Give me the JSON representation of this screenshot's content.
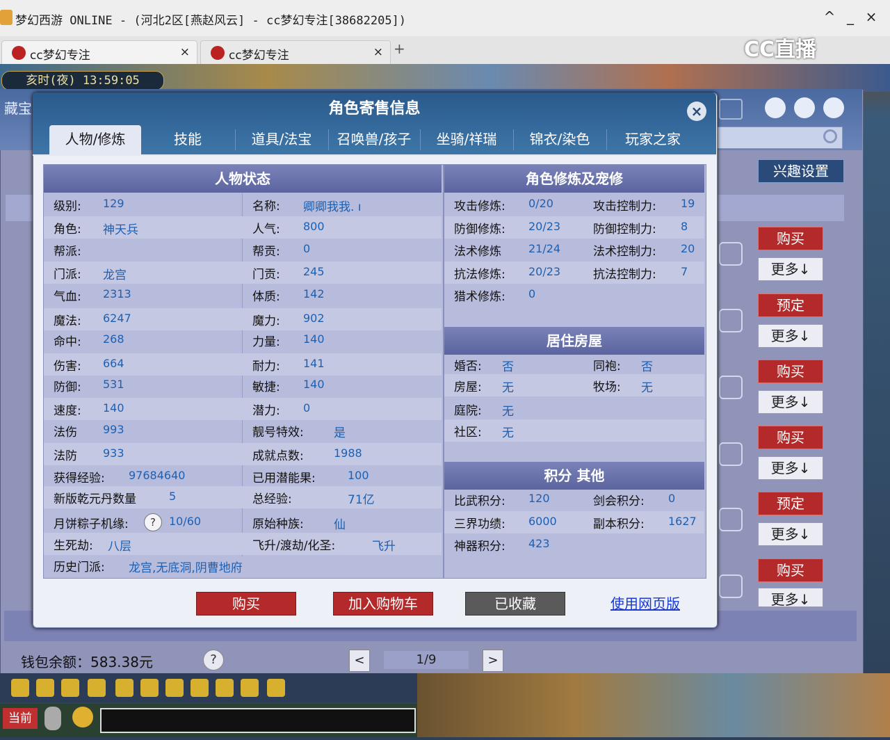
{
  "window": {
    "title": "梦幻西游 ONLINE - (河北2区[燕赵风云] - cc梦幻专注[38682205])",
    "controls": [
      "^",
      "_",
      "×"
    ]
  },
  "browser_tabs": [
    {
      "label": "cc梦幻专注",
      "close": "×"
    },
    {
      "label": "cc梦幻专注",
      "close": "×"
    }
  ],
  "new_tab": "+",
  "cc_logo": "CC直播",
  "game": {
    "clock": "亥时(夜) 13:59:05",
    "cangbao_label": "藏宝"
  },
  "back_window": {
    "interest_btn": "兴趣设置",
    "side_buttons": [
      "购买",
      "更多↓",
      "预定",
      "更多↓",
      "购买",
      "更多↓",
      "购买",
      "更多↓",
      "预定",
      "更多↓",
      "购买",
      "更多↓"
    ],
    "wallet": "钱包余额：583.38元",
    "wallet_help": "?",
    "page": "1/9",
    "prev": "<",
    "next": ">"
  },
  "chat": {
    "channel": "当前"
  },
  "modal": {
    "title": "角色寄售信息",
    "close": "×",
    "tabs": [
      "人物/修炼",
      "技能",
      "道具/法宝",
      "召唤兽/孩子",
      "坐骑/祥瑞",
      "锦衣/染色",
      "玩家之家"
    ],
    "status": {
      "title": "人物状态",
      "left": [
        {
          "label": "级别:",
          "value": "129"
        },
        {
          "label": "角色:",
          "value": "神天兵"
        },
        {
          "label": "帮派:",
          "value": ""
        },
        {
          "label": "门派:",
          "value": "龙宫"
        },
        {
          "label": "气血:",
          "value": "2313"
        },
        {
          "label": "魔法:",
          "value": "6247"
        },
        {
          "label": "命中:",
          "value": "268"
        },
        {
          "label": "伤害:",
          "value": "664"
        },
        {
          "label": "防御:",
          "value": "531"
        },
        {
          "label": "速度:",
          "value": "140"
        },
        {
          "label": "法伤",
          "value": "993"
        },
        {
          "label": "法防",
          "value": "933"
        },
        {
          "label": "获得经验:",
          "value": "97684640"
        },
        {
          "label": "新版乾元丹数量",
          "value": "5"
        },
        {
          "label": "月饼粽子机缘:",
          "value": "10/60"
        },
        {
          "label": "生死劫:",
          "value": "八层"
        },
        {
          "label": "历史门派:",
          "value": "龙宫,无底洞,阴曹地府"
        }
      ],
      "right": [
        {
          "label": "名称:",
          "value": "卿卿我我. ı"
        },
        {
          "label": "人气:",
          "value": "800"
        },
        {
          "label": "帮贡:",
          "value": "0"
        },
        {
          "label": "门贡:",
          "value": "245"
        },
        {
          "label": "体质:",
          "value": "142"
        },
        {
          "label": "魔力:",
          "value": "902"
        },
        {
          "label": "力量:",
          "value": "140"
        },
        {
          "label": "耐力:",
          "value": "141"
        },
        {
          "label": "敏捷:",
          "value": "140"
        },
        {
          "label": "潜力:",
          "value": "0"
        },
        {
          "label": "靓号特效:",
          "value": "是"
        },
        {
          "label": "成就点数:",
          "value": "1988"
        },
        {
          "label": "已用潜能果:",
          "value": "100"
        },
        {
          "label": "总经验:",
          "value": "71亿"
        },
        {
          "label": "原始种族:",
          "value": "仙"
        },
        {
          "label": "飞升/渡劫/化圣:",
          "value": "飞升"
        }
      ],
      "help": "?"
    },
    "cultivation": {
      "title": "角色修炼及宠修",
      "rows": [
        {
          "l1": "攻击修炼:",
          "v1": "0/20",
          "l2": "攻击控制力:",
          "v2": "19"
        },
        {
          "l1": "防御修炼:",
          "v1": "20/23",
          "l2": "防御控制力:",
          "v2": "8"
        },
        {
          "l1": "法术修炼",
          "v1": "21/24",
          "l2": "法术控制力:",
          "v2": "20"
        },
        {
          "l1": "抗法修炼:",
          "v1": "20/23",
          "l2": "抗法控制力:",
          "v2": "7"
        },
        {
          "l1": "猎术修炼:",
          "v1": "0",
          "l2": "",
          "v2": ""
        }
      ]
    },
    "house": {
      "title": "居住房屋",
      "rows": [
        {
          "l1": "婚否:",
          "v1": "否",
          "l2": "同袍:",
          "v2": "否"
        },
        {
          "l1": "房屋:",
          "v1": "无",
          "l2": "牧场:",
          "v2": "无"
        },
        {
          "l1": "庭院:",
          "v1": "无",
          "l2": "",
          "v2": ""
        },
        {
          "l1": "社区:",
          "v1": "无",
          "l2": "",
          "v2": ""
        }
      ]
    },
    "points": {
      "title": "积分 其他",
      "rows": [
        {
          "l1": "比武积分:",
          "v1": "120",
          "l2": "剑会积分:",
          "v2": "0"
        },
        {
          "l1": "三界功绩:",
          "v1": "6000",
          "l2": "副本积分:",
          "v2": "1627"
        },
        {
          "l1": "神器积分:",
          "v1": "423",
          "l2": "",
          "v2": ""
        }
      ]
    },
    "buttons": {
      "buy": "购买",
      "cart": "加入购物车",
      "fav": "已收藏",
      "web": "使用网页版"
    }
  }
}
